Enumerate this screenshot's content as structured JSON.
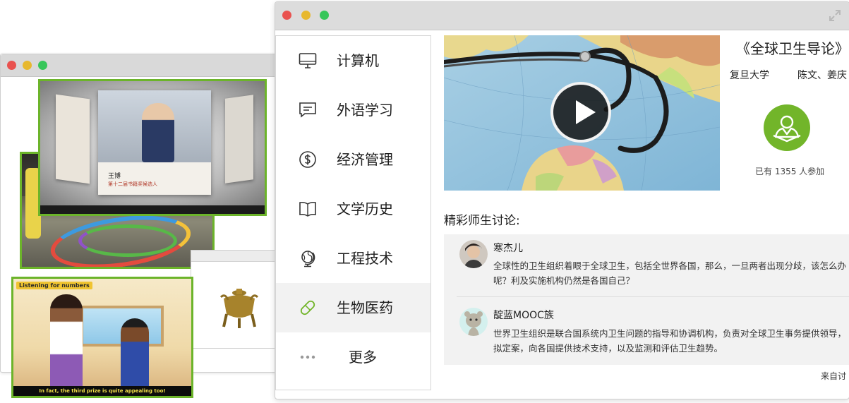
{
  "back_window": {
    "cartoon_tag": "Listening for numbers",
    "cartoon_caption": "In fact, the third prize is quite appealing too!",
    "video_presenter_name": "王博",
    "video_presenter_sub": "第十二届书籍奖候选人"
  },
  "sidebar": {
    "items": [
      {
        "label": "计算机",
        "icon": "monitor-icon"
      },
      {
        "label": "外语学习",
        "icon": "speech-bubble-icon"
      },
      {
        "label": "经济管理",
        "icon": "dollar-coin-icon"
      },
      {
        "label": "文学历史",
        "icon": "open-book-icon"
      },
      {
        "label": "工程技术",
        "icon": "globe-icon"
      },
      {
        "label": "生物医药",
        "icon": "pill-icon",
        "active": true
      },
      {
        "label": "更多",
        "icon": "ellipsis-icon"
      }
    ]
  },
  "course": {
    "title": "《全球卫生导论》",
    "school": "复旦大学",
    "teachers": "陈文、姜庆",
    "join_count": "已有 1355 人参加"
  },
  "discussion": {
    "title": "精彩师生讨论:",
    "posts": [
      {
        "author": "寒杰儿",
        "body": "全球性的卫生组织着眼于全球卫生，包括全世界各国，那么，一旦两者出现分歧，该怎么办呢？利及实施机构仍然是各国自己？"
      },
      {
        "author": "靛蓝MOOC族",
        "body": "世界卫生组织是联合国系统内卫生问题的指导和协调机构，负责对全球卫生事务提供领导，拟定案，向各国提供技术支持，以及监测和评估卫生趋势。"
      }
    ],
    "source_note": "来自讨"
  },
  "colors": {
    "accent_green": "#72b52a",
    "thumb_border": "#6cb42a",
    "close_red": "#e9524f",
    "min_yellow": "#e7b82e",
    "zoom_green": "#37c65a"
  }
}
